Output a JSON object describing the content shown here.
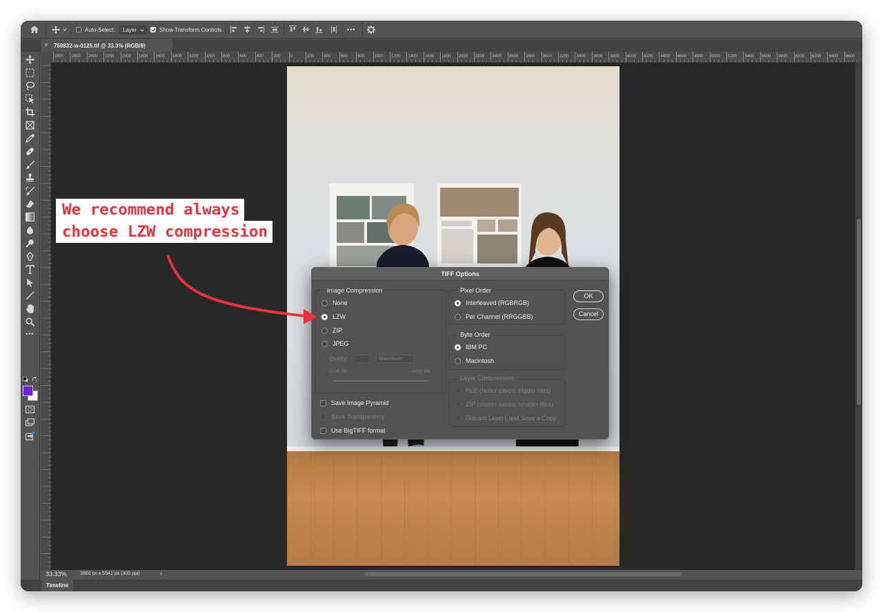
{
  "options_bar": {
    "auto_select_label": "Auto-Select:",
    "auto_select_checked": false,
    "layer_select_value": "Layer",
    "show_transform_label": "Show Transform Controls",
    "show_transform_checked": true,
    "more_label": "•••"
  },
  "document_tab": {
    "title": "759832-w-0125.tif @ 33.3% (RGB/8)",
    "close_glyph": "×"
  },
  "ruler": {
    "top_labels": [
      "2800",
      "2600",
      "2400",
      "2200",
      "2000",
      "1800",
      "1600",
      "1400",
      "1200",
      "1000",
      "800",
      "600",
      "400",
      "200",
      "0",
      "200",
      "400",
      "600",
      "800",
      "1000",
      "1200",
      "1400",
      "1600",
      "1800",
      "2000",
      "2200",
      "2400",
      "2600",
      "2800",
      "3000",
      "3200",
      "3400",
      "3600",
      "3800",
      "4000",
      "4200",
      "4400",
      "4600",
      "4800",
      "5000",
      "5200",
      "5400",
      "5600",
      "5800",
      "6000",
      "6200",
      "6400",
      "6600"
    ]
  },
  "status_bar": {
    "zoom": "33.33%",
    "doc_info": "3960 px x 5941 px (300 ppi)",
    "arrow": "›"
  },
  "timeline": {
    "label": "Timeline"
  },
  "dialog": {
    "title": "TIFF Options",
    "image_compression": {
      "title": "Image Compression",
      "options": [
        "None",
        "LZW",
        "ZIP",
        "JPEG"
      ],
      "selected": "LZW",
      "quality_label": "Quality:",
      "quality_select": "Maximum",
      "small_file": "small file",
      "large_file": "large file"
    },
    "pixel_order": {
      "title": "Pixel Order",
      "options": [
        "Interleaved (RGBRGB)",
        "Per Channel (RRGGBB)"
      ],
      "selected": "Interleaved (RGBRGB)"
    },
    "byte_order": {
      "title": "Byte Order",
      "options": [
        "IBM PC",
        "Macintosh"
      ],
      "selected": "IBM PC"
    },
    "layer_compression": {
      "title": "Layer Compression",
      "options": [
        "RLE (faster saves, bigger files)",
        "ZIP (slower saves, smaller files)",
        "Discard Layers and Save a Copy"
      ]
    },
    "checkboxes": {
      "save_image_pyramid": "Save Image Pyramid",
      "save_transparency": "Save Transparency",
      "use_bigtiff": "Use BigTIFF format"
    },
    "ok_label": "OK",
    "cancel_label": "Cancel"
  },
  "annotation": {
    "line1": "We recommend always",
    "line2": "choose LZW compression",
    "color": "#e8323c"
  },
  "colors": {
    "foreground": "#6a1fd0",
    "background": "#ffffff",
    "ui_panel": "#535353",
    "canvas_bg": "#282828"
  }
}
